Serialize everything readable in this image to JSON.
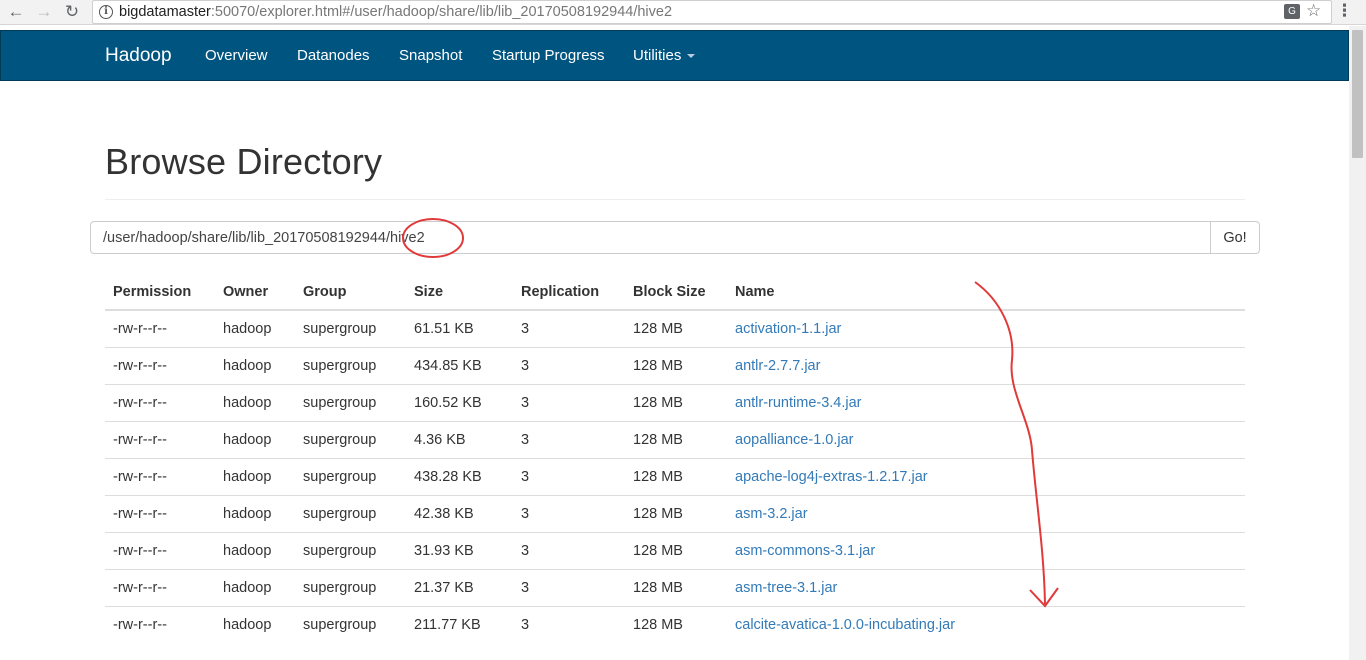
{
  "browser": {
    "url_host": "bigdatamaster",
    "url_rest": ":50070/explorer.html#/user/hadoop/share/lib/lib_20170508192944/hive2",
    "back_icon": "arrow-left-icon",
    "forward_icon": "arrow-right-icon",
    "reload_icon": "reload-icon"
  },
  "navbar": {
    "brand": "Hadoop",
    "items": [
      "Overview",
      "Datanodes",
      "Snapshot",
      "Startup Progress",
      "Utilities"
    ],
    "bg_color": "#005580"
  },
  "page": {
    "title": "Browse Directory",
    "path_value": "/user/hadoop/share/lib/lib_20170508192944/hive2",
    "go_label": "Go!"
  },
  "table": {
    "headers": [
      "Permission",
      "Owner",
      "Group",
      "Size",
      "Replication",
      "Block Size",
      "Name"
    ],
    "rows": [
      [
        "-rw-r--r--",
        "hadoop",
        "supergroup",
        "61.51 KB",
        "3",
        "128 MB",
        "activation-1.1.jar"
      ],
      [
        "-rw-r--r--",
        "hadoop",
        "supergroup",
        "434.85 KB",
        "3",
        "128 MB",
        "antlr-2.7.7.jar"
      ],
      [
        "-rw-r--r--",
        "hadoop",
        "supergroup",
        "160.52 KB",
        "3",
        "128 MB",
        "antlr-runtime-3.4.jar"
      ],
      [
        "-rw-r--r--",
        "hadoop",
        "supergroup",
        "4.36 KB",
        "3",
        "128 MB",
        "aopalliance-1.0.jar"
      ],
      [
        "-rw-r--r--",
        "hadoop",
        "supergroup",
        "438.28 KB",
        "3",
        "128 MB",
        "apache-log4j-extras-1.2.17.jar"
      ],
      [
        "-rw-r--r--",
        "hadoop",
        "supergroup",
        "42.38 KB",
        "3",
        "128 MB",
        "asm-3.2.jar"
      ],
      [
        "-rw-r--r--",
        "hadoop",
        "supergroup",
        "31.93 KB",
        "3",
        "128 MB",
        "asm-commons-3.1.jar"
      ],
      [
        "-rw-r--r--",
        "hadoop",
        "supergroup",
        "21.37 KB",
        "3",
        "128 MB",
        "asm-tree-3.1.jar"
      ],
      [
        "-rw-r--r--",
        "hadoop",
        "supergroup",
        "211.77 KB",
        "3",
        "128 MB",
        "calcite-avatica-1.0.0-incubating.jar"
      ]
    ]
  },
  "annotation_color": "#e03a3a",
  "link_color": "#337ab7"
}
